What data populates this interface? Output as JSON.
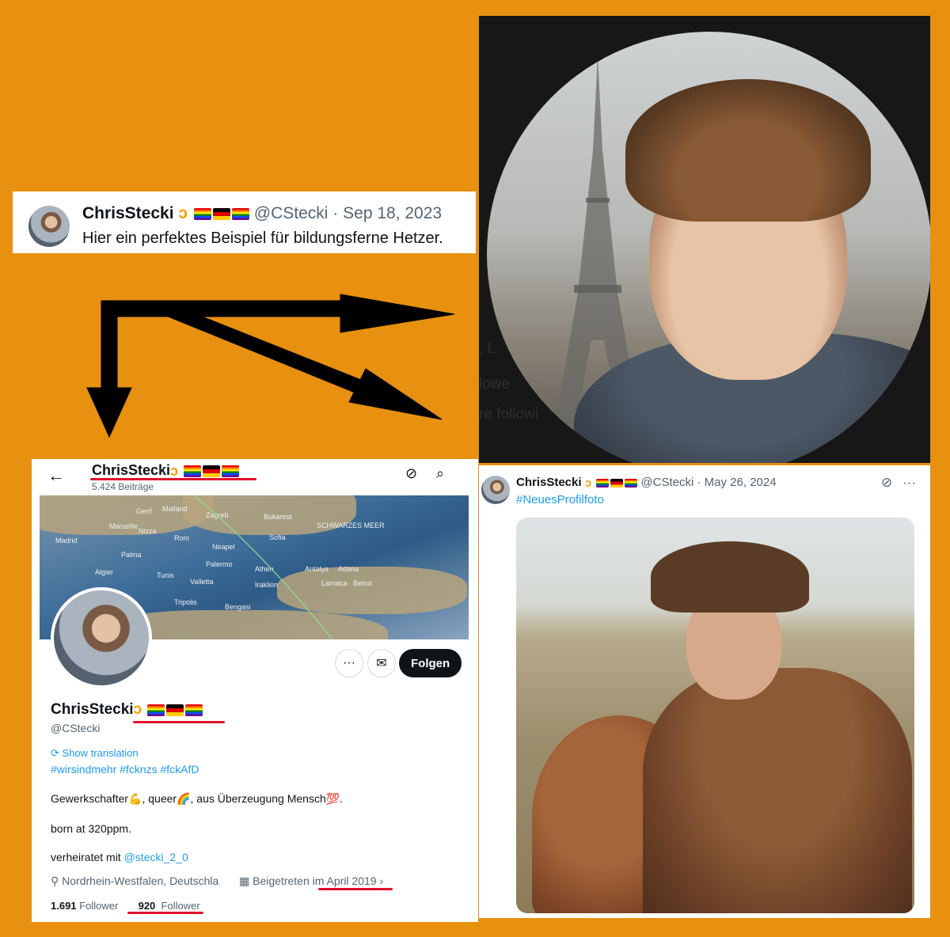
{
  "tweet_a": {
    "name": "ChrisStecki",
    "handle": "@CStecki",
    "date": "Sep 18, 2023",
    "text": "Hier ein perfektes Beispiel für bildungsferne Hetzer."
  },
  "portrait_panel": {
    "ghost_texts": [
      "f",
      ", L",
      "lowe",
      "re followi"
    ]
  },
  "profile": {
    "header_name": "ChrisStecki",
    "header_posts": "5.424 Beiträge",
    "back_icon": "←",
    "name": "ChrisStecki",
    "handle": "@CStecki",
    "show_translation": "Show translation",
    "hashtags": "#wirsindmehr #fcknzs #fckAfD",
    "bio_line1_a": "Gewerkschafter",
    "bio_line1_b": ", queer",
    "bio_line1_c": ", aus Überzeugung Mensch",
    "bio_line2": "born at 320ppm.",
    "bio_line3_prefix": "verheiratet mit",
    "bio_line3_mention": "@stecki_2_0",
    "location": "Nordrhein-Westfalen, Deutschla",
    "joined_prefix": "Beigetreten im",
    "joined_date": "April 2019",
    "following_count": "1.691",
    "following_label": "Follower",
    "followers_count": "920",
    "followers_label": "Follower",
    "follow_button": "Folgen",
    "banner_cities": [
      "Mailand",
      "Genf",
      "Zagreb",
      "Marseille",
      "Nizza",
      "Bukarest",
      "SCHWARZES MEER",
      "Rom",
      "Sofia",
      "Neapel",
      "Palma",
      "Athen",
      "Antalya",
      "Adana",
      "Palermo",
      "Tunis",
      "Valletta",
      "Iraklion",
      "Larnaca",
      "Beirut",
      "Tripolis",
      "Bengasi",
      "Madrid",
      "Algier"
    ]
  },
  "tweet_d": {
    "name": "ChrisStecki",
    "handle": "@CStecki",
    "date": "May 26, 2024",
    "hashtag": "#NeuesProfilfoto"
  },
  "colors": {
    "background": "#E8900F",
    "underline": "#e0102a",
    "link": "#1d9bf0",
    "follow_button": "#0f1419"
  }
}
